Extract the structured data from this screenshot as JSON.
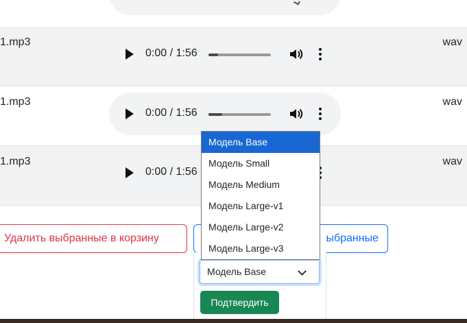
{
  "rows": [
    {
      "filename": "1.mp3",
      "format": "wav",
      "time": "0:00 / 1:56",
      "progress": 0.15
    },
    {
      "filename": "1.mp3",
      "format": "wav",
      "time": "0:00 / 1:56",
      "progress": 0.22
    },
    {
      "filename": "1.mp3",
      "format": "wav",
      "time": "0:00 / 1:56",
      "progress": 0.0
    }
  ],
  "actions": {
    "delete_label": "Удалить выбранные в корзину",
    "process_label": "ыбранные"
  },
  "model_select": {
    "selected": "Модель Base",
    "options": [
      "Модель Base",
      "Модель Small",
      "Модель Medium",
      "Модель Large-v1",
      "Модель Large-v2",
      "Модель Large-v3"
    ],
    "confirm_label": "Подтвердить"
  },
  "colors": {
    "danger": "#dc3545",
    "primary": "#0d6efd",
    "success": "#198754",
    "option_highlight": "#1967d2"
  }
}
